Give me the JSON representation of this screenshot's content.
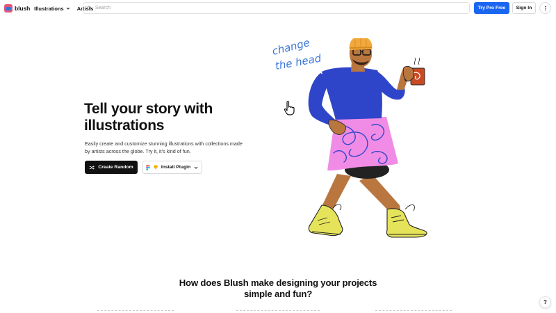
{
  "header": {
    "brand": "blush",
    "nav": [
      {
        "label": "Illustrations",
        "has_dropdown": true
      },
      {
        "label": "Artists",
        "has_dropdown": false
      }
    ],
    "search_placeholder": "Search",
    "try_pro_label": "Try Pro Free",
    "sign_in_label": "Sign In"
  },
  "hero": {
    "title": "Tell your story with illustrations",
    "subtitle": "Easily create and customize stunning illustrations with collections made by artists across the globe. Try it, it's kind of fun.",
    "create_random_label": "Create Random",
    "install_plugin_label": "Install Plugin",
    "annotation_line1": "change",
    "annotation_line2": "the head"
  },
  "section": {
    "title": "How does Blush make designing your projects simple and fun?"
  },
  "help_label": "?",
  "colors": {
    "primary_blue": "#1a66f0",
    "dark_button": "#111111",
    "shirt_blue": "#2f45c9",
    "skirt_pink": "#f08ce6",
    "shoe_yellow": "#e5e35a",
    "hat_orange": "#f2a93b",
    "mug_red": "#c94a22",
    "skin": "#b9763f",
    "annotation_blue": "#3a76d8"
  }
}
